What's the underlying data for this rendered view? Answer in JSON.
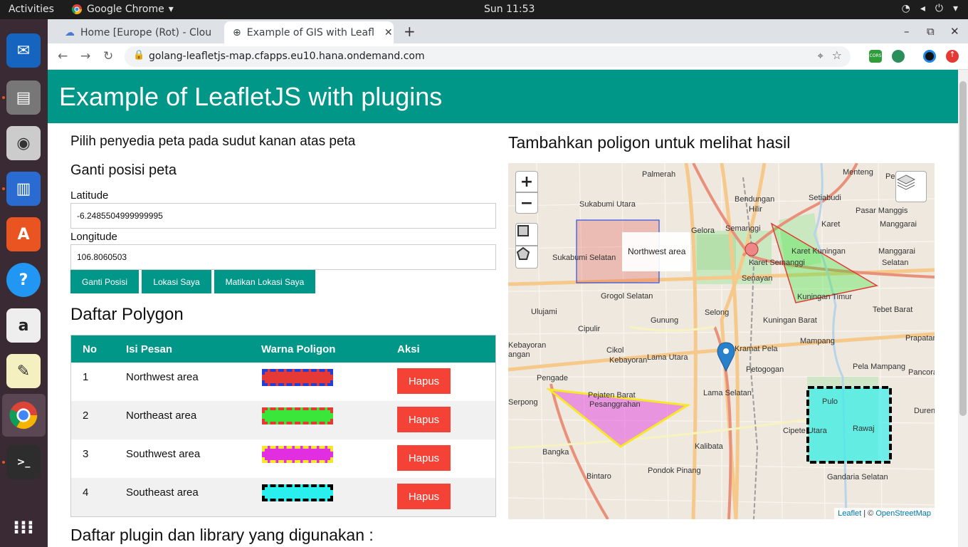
{
  "os": {
    "activities": "Activities",
    "app_name": "Google Chrome",
    "clock": "Sun 11:53",
    "tray": [
      "▾",
      "◂)",
      "⏻ ▾"
    ]
  },
  "browser": {
    "tabs": [
      {
        "label": "Home [Europe (Rot) - Clou"
      },
      {
        "label": "Example of GIS with Leafl"
      }
    ],
    "new_tab": "+",
    "url": "golang-leafletjs-map.cfapps.eu10.hana.ondemand.com",
    "win_min": "–",
    "win_max": "⧉",
    "win_close": "✕",
    "ext_badge": "CORS"
  },
  "page": {
    "header_title": "Example of LeafletJS with plugins",
    "left_subtitle": "Pilih penyedia peta pada sudut kanan atas peta",
    "section_position": "Ganti posisi peta",
    "latitude_label": "Latitude",
    "latitude_value": "-6.2485504999999995",
    "longitude_label": "Longitude",
    "longitude_value": "106.8060503",
    "btn_change": "Ganti Posisi",
    "btn_locate": "Lokasi Saya",
    "btn_stop": "Matikan Lokasi Saya",
    "section_polygons": "Daftar Polygon",
    "table_headers": [
      "No",
      "Isi Pesan",
      "Warna Poligon",
      "Aksi"
    ],
    "rows": [
      {
        "no": "1",
        "message": "Northwest area",
        "action": "Hapus",
        "border": "#1f3fd6",
        "fill": "#e53935"
      },
      {
        "no": "2",
        "message": "Northeast area",
        "action": "Hapus",
        "border": "#e53935",
        "fill": "#39e639"
      },
      {
        "no": "3",
        "message": "Southwest area",
        "action": "Hapus",
        "border": "#f7e62a",
        "fill": "#e02ee0"
      },
      {
        "no": "4",
        "message": "Southeast area",
        "action": "Hapus",
        "border": "#000000",
        "fill": "#29f0ee"
      }
    ],
    "section_plugins": "Daftar plugin dan library yang digunakan :",
    "map_title": "Tambahkan poligon untuk melihat hasil"
  },
  "map": {
    "zoom_in": "+",
    "zoom_out": "−",
    "tooltip": "Northwest area",
    "attr_leaflet": "Leaflet",
    "attr_sep": " | © ",
    "attr_osm": "OpenStreetMap",
    "places": [
      "Palmerah",
      "Menteng",
      "Pegan",
      "Bendungan",
      "Hilir",
      "Setiabudi",
      "Pasar Manggis",
      "Sukabumi Utara",
      "Karet",
      "Manggarai",
      "Gelora",
      "Semanggi",
      "Karet Kuningan",
      "Manggarai",
      "Sukabumi Selatan",
      "Selatan",
      "Karet Semanggi",
      "Senayan",
      "Kuningan Timur",
      "Tebet Barat",
      "Grogol Selatan",
      "Ulujami",
      "Selong",
      "Gunung",
      "Kuningan Barat",
      "Cipulir",
      "Mampang",
      "Prapatan",
      "Cikol",
      "Kebayoran",
      "Lama Utara",
      "Kramat Pela",
      "Petogogan",
      "Pela Mampang",
      "Pancoran",
      "Pengade",
      "Serpong",
      "Pesanggrahan",
      "Lama Selatan",
      "Pulo",
      "Duren Tiga",
      "Rawaj",
      "Kalibata",
      "Cipete Utara",
      "Bangka",
      "Bintaro",
      "Pondok Pinang",
      "Gandaria Selatan",
      "Pejaten Barat",
      "Kebayoran",
      "angan",
      "Barat"
    ]
  },
  "colors": {
    "teal": "#009688",
    "red": "#f44336"
  }
}
